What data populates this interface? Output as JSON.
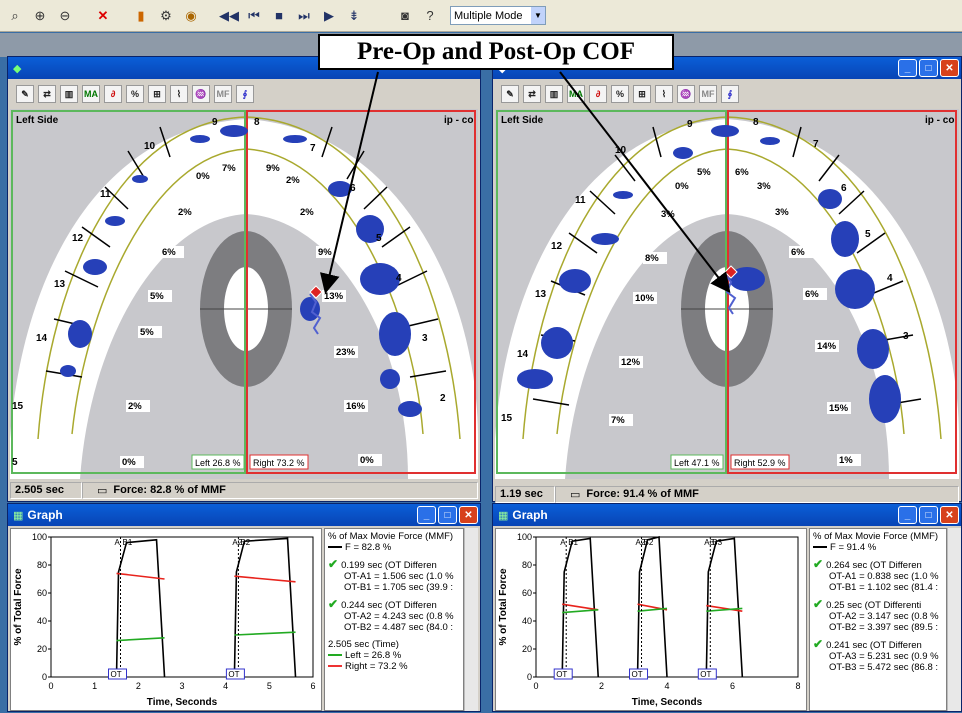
{
  "toolbar": {
    "mode_value": "Multiple Mode",
    "icons": [
      "magnify-icon",
      "zoom-icon",
      "delete-icon",
      "color-bar-icon",
      "settings-icon",
      "stop-icon",
      "rewind-icon",
      "first-frame-icon",
      "stop-square-icon",
      "last-frame-icon",
      "play-icon",
      "step-icon",
      "camera-icon",
      "help-icon"
    ]
  },
  "callout": {
    "text": "Pre-Op and Post-Op COF"
  },
  "left": {
    "side_label": "Left Side",
    "corner_label": "ip - co",
    "teeth": [
      "9",
      "10",
      "11",
      "12",
      "13",
      "14",
      "15",
      "8",
      "7",
      "6",
      "5",
      "4",
      "3",
      "2",
      "5"
    ],
    "percents": [
      "7%",
      "0%",
      "2%",
      "6%",
      "5%",
      "5%",
      "2%",
      "0%",
      "9%",
      "2%",
      "2%",
      "9%",
      "13%",
      "23%",
      "16%",
      "0%"
    ],
    "left_total": "Left 26.8 %",
    "right_total": "Right 73.2 %",
    "time": "2.505 sec",
    "force": "Force: 82.8 % of MMF"
  },
  "right": {
    "side_label": "Left Side",
    "corner_label": "ip - co",
    "teeth": [
      "9",
      "10",
      "11",
      "12",
      "13",
      "14",
      "15",
      "8",
      "7",
      "6",
      "5",
      "4",
      "3"
    ],
    "percents": [
      "5%",
      "0%",
      "3%",
      "8%",
      "10%",
      "12%",
      "7%",
      "6%",
      "3%",
      "3%",
      "6%",
      "6%",
      "14%",
      "15%",
      "1%"
    ],
    "left_total": "Left 47.1 %",
    "right_total": "Right 52.9 %",
    "time": "1.19 sec",
    "force": "Force: 91.4 % of MMF"
  },
  "graph_left": {
    "title": "Graph",
    "ylabel": "% of Total Force",
    "xlabel": "Time, Seconds",
    "yticks": [
      "100",
      "80",
      "60",
      "40",
      "20",
      "0"
    ],
    "xticks": [
      "0",
      "1",
      "2",
      "3",
      "4",
      "5",
      "6"
    ],
    "markers": [
      "A",
      "B1",
      "A2",
      "B2",
      "OT",
      "OT"
    ],
    "legend": [
      "% of Max Movie Force (MMF)",
      "F = 82.8 %",
      "0.199 sec (OT Differen",
      "OT-A1 = 1.506 sec (1.0 %",
      "OT-B1 = 1.705 sec (39.9 :",
      "0.244 sec (OT Differen",
      "OT-A2 = 4.243 sec (0.8 %",
      "OT-B2 = 4.487 sec (84.0 :",
      "2.505 sec (Time)",
      "Left = 26.8 %",
      "Right = 73.2 %"
    ]
  },
  "graph_right": {
    "title": "Graph",
    "ylabel": "% of Total Force",
    "xlabel": "Time, Seconds",
    "yticks": [
      "100",
      "80",
      "60",
      "40",
      "20",
      "0"
    ],
    "xticks": [
      "0",
      "2",
      "4",
      "6",
      "8"
    ],
    "markers": [
      "A",
      "B1",
      "A2",
      "B2",
      "A3",
      "B3",
      "OT",
      "OT",
      "OT"
    ],
    "legend": [
      "% of Max Movie Force (MMF)",
      "F = 91.4 %",
      "0.264 sec (OT Differen",
      "OT-A1 = 0.838 sec (1.0 %",
      "OT-B1 = 1.102 sec (81.4 :",
      "0.25 sec (OT Differenti",
      "OT-A2 = 3.147 sec (0.8 %",
      "OT-B2 = 3.397 sec (89.5 :",
      "0.241 sec (OT Differen",
      "OT-A3 = 5.231 sec (0.9 %",
      "OT-B3 = 5.472 sec (86.8 :"
    ]
  },
  "colors": {
    "total": "#000000",
    "left": "#22aa22",
    "right": "#e8231c",
    "accent": "#0a5fd8"
  }
}
